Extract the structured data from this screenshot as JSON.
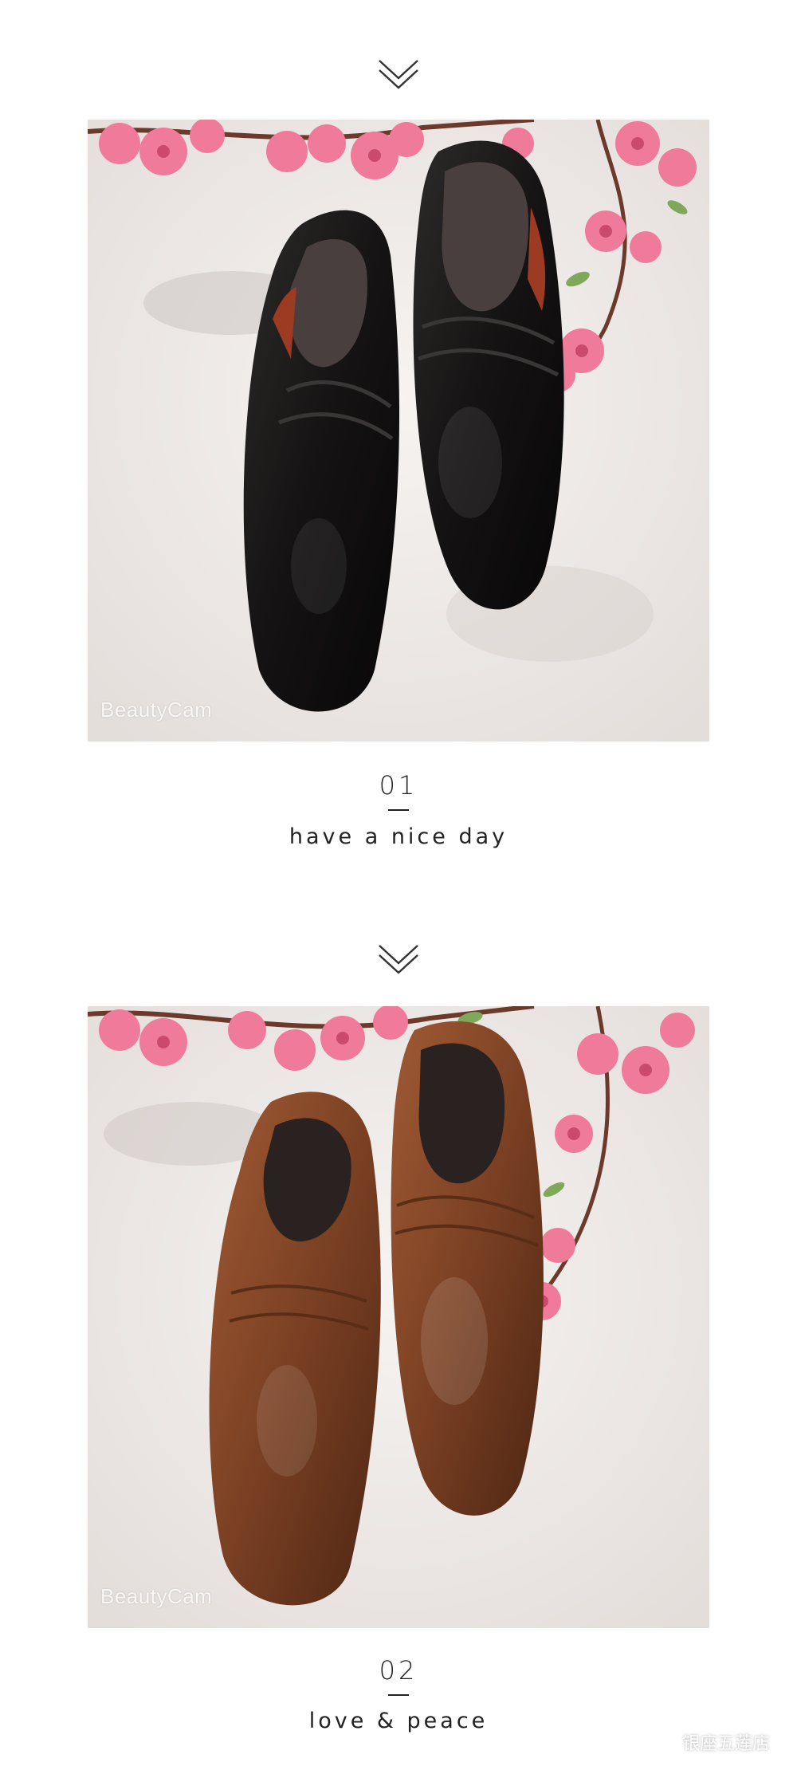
{
  "sections": [
    {
      "number": "01",
      "caption": "have a nice day",
      "watermark": "BeautyCam",
      "shoe_color": "#1c1a1a",
      "icon": "chevron-down-double-icon"
    },
    {
      "number": "02",
      "caption": "love & peace",
      "watermark": "BeautyCam",
      "shoe_color": "#7a4023",
      "icon": "chevron-down-double-icon"
    }
  ],
  "footer": {
    "account_name": "银座五莲店",
    "icon": "wechat-icon"
  },
  "colors": {
    "text": "#222222",
    "blossom": "#f07a9a",
    "background": "#ffffff"
  }
}
